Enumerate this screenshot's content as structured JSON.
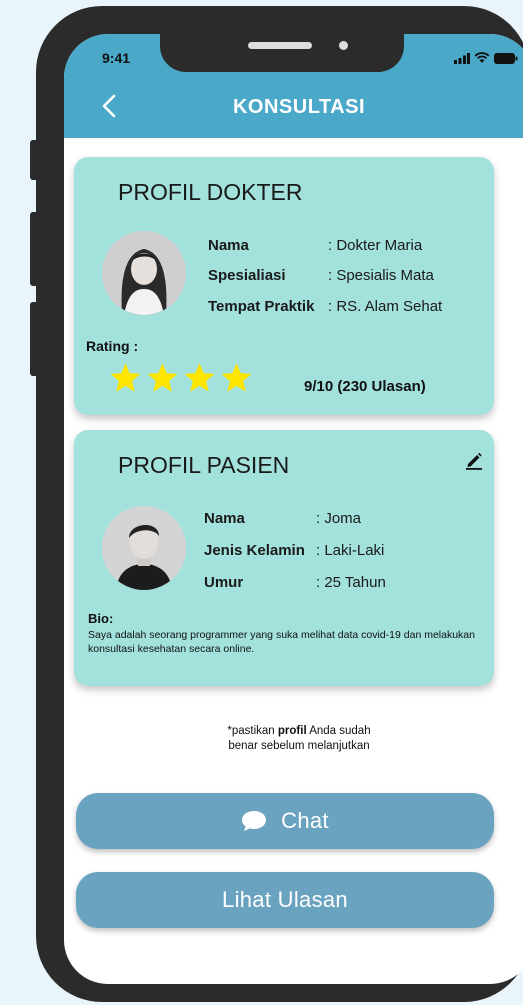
{
  "status_bar": {
    "time": "9:41",
    "icons": [
      "signal-icon",
      "wifi-icon",
      "battery-icon"
    ]
  },
  "header": {
    "title": "KONSULTASI",
    "back_icon": "chevron-left-icon"
  },
  "doctor_profile": {
    "title": "PROFIL DOKTER",
    "fields": [
      {
        "label": "Nama",
        "value": ": Dokter Maria"
      },
      {
        "label": "Spesialiasi",
        "value": ": Spesialis Mata"
      },
      {
        "label": "Tempat Praktik",
        "value": ": RS. Alam Sehat"
      }
    ],
    "rating_label": "Rating :",
    "stars": 4,
    "rating_text": "9/10  (230 Ulasan)"
  },
  "patient_profile": {
    "title": "PROFIL PASIEN",
    "edit_icon": "pencil-icon",
    "fields": [
      {
        "label": "Nama",
        "value": ": Joma"
      },
      {
        "label": "Jenis Kelamin",
        "value": ": Laki-Laki"
      },
      {
        "label": "Umur",
        "value": ": 25 Tahun"
      }
    ],
    "bio_label": "Bio:",
    "bio_text": "Saya adalah seorang programmer yang suka melihat data covid-19 dan melakukan konsultasi kesehatan secara online."
  },
  "note": {
    "prefix": "*pastikan ",
    "bold": "profil",
    "suffix": " Anda sudah",
    "line2": "benar sebelum melanjutkan"
  },
  "buttons": {
    "chat_label": "Chat",
    "chat_icon": "chat-bubble-icon",
    "reviews_label": "Lihat Ulasan"
  },
  "colors": {
    "header": "#4aa8c8",
    "card": "#a2e1dc",
    "button": "#6aa3bf",
    "star": "#ffe600",
    "background": "#eaf5fb"
  }
}
